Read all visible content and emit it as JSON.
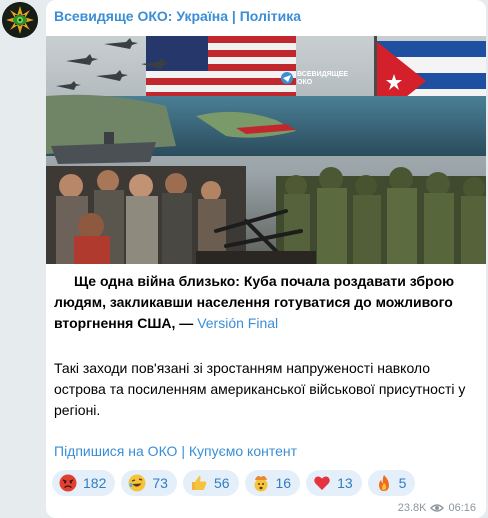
{
  "channel": {
    "name": "Всевидяще ОКО: Україна | Політика",
    "avatar_icon": "eye-emblem-icon"
  },
  "image": {
    "watermark_line1": "ВСЕВИДЯЩЕЕ",
    "watermark_line2": "ОКО",
    "description_icons": [
      "us-flag",
      "cuba-flag",
      "fighter-jets",
      "aircraft-carrier",
      "soldiers",
      "crowd"
    ]
  },
  "post": {
    "headline": "Ще одна війна близько: Куба почала роздавати зброю людям, закликавши населення готуватися до можливого вторгнення США, —",
    "source_link": "Versión Final",
    "paragraph": "Такі заходи пов'язані зі зростанням напруженості навколо острова та посиленням американської військової присутності у регіоні.",
    "footer_link_1": "Підпишися на ОКО",
    "footer_separator": "|",
    "footer_link_2": "Купуємо контент"
  },
  "reactions": [
    {
      "emoji": "angry-face",
      "count": "182"
    },
    {
      "emoji": "rofl-face",
      "count": "73"
    },
    {
      "emoji": "thumbs-up",
      "count": "56"
    },
    {
      "emoji": "exploding-head",
      "count": "16"
    },
    {
      "emoji": "red-heart",
      "count": "13"
    },
    {
      "emoji": "fire",
      "count": "5"
    }
  ],
  "meta": {
    "views": "23.8K",
    "time": "06:16"
  },
  "colors": {
    "accent": "#3a8ed6",
    "background": "#e6ebee",
    "reaction_bg": "#e4eff9"
  }
}
